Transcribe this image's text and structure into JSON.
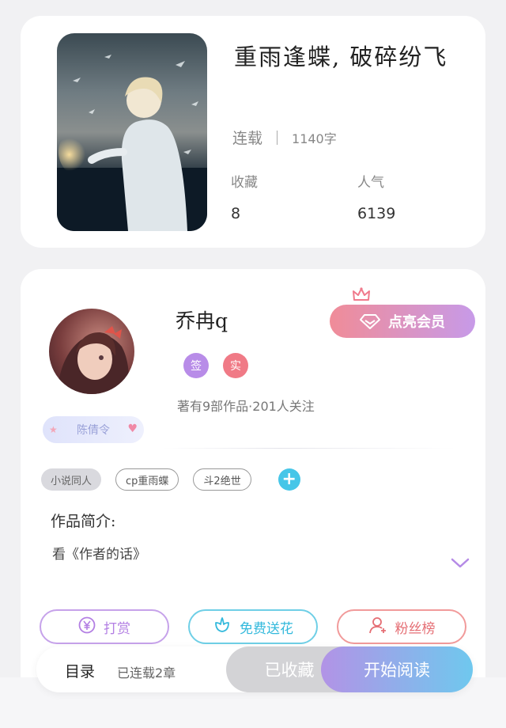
{
  "book": {
    "title": "重雨逢蝶, 破碎纷飞",
    "status": "连载",
    "word_count": "1140字",
    "favorites_label": "收藏",
    "favorites_value": "8",
    "popularity_label": "人气",
    "popularity_value": "6139"
  },
  "author": {
    "name": "乔冉q",
    "badge_sign": "签",
    "badge_real": "实",
    "stats": "著有9部作品·201人关注",
    "fan_badge": "陈倩令",
    "vip_button": "点亮会员"
  },
  "tags": [
    "小说同人",
    "cp重雨蝶",
    "斗2绝世"
  ],
  "intro": {
    "label": "作品简介:",
    "text": "看《作者的话》"
  },
  "actions": {
    "tip": "打赏",
    "flower": "免费送花",
    "fans": "粉丝榜"
  },
  "bottom_bar": {
    "toc": "目录",
    "toc_status": "已连载2章",
    "collected": "已收藏",
    "read": "开始阅读"
  },
  "colors": {
    "accent_purple": "#b37fe3",
    "accent_cyan": "#33b9dc",
    "accent_pink": "#e56e74",
    "tag_add": "#46c6e8"
  },
  "icons": [
    "crown-icon",
    "gem-icon",
    "yen-icon",
    "flower-icon",
    "user-icon",
    "chevron-down-icon",
    "plus-icon"
  ]
}
